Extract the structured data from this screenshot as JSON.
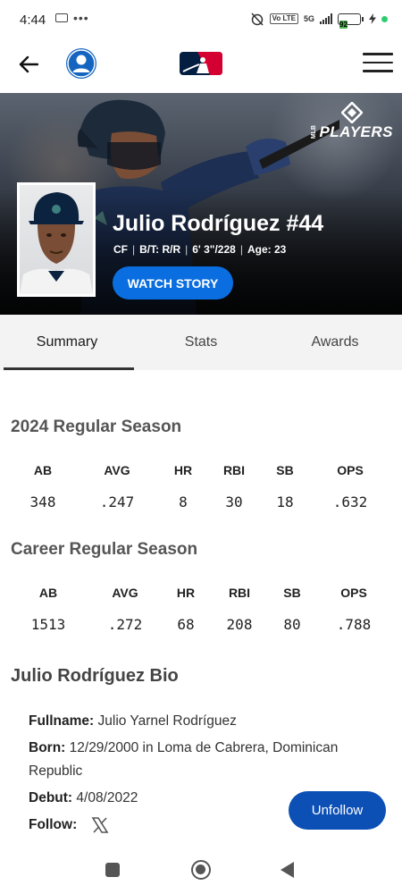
{
  "status_bar": {
    "time": "4:44",
    "dots": "•••",
    "network": "5G",
    "volte": "Vo LTE",
    "battery": "92"
  },
  "header": {
    "back_icon": "arrow-left-icon",
    "profile_icon": "user-circle-icon",
    "logo": "mlb-logo",
    "menu_icon": "hamburger-menu-icon"
  },
  "hero": {
    "players_logo_text": "PLAYERS",
    "players_logo_small": "MLB",
    "player_name": "Julio Rodríguez #44",
    "position": "CF",
    "bats_throws": "B/T: R/R",
    "height_weight": "6' 3\"/228",
    "age": "Age: 23",
    "watch_story_label": "WATCH STORY"
  },
  "tabs": [
    {
      "label": "Summary",
      "active": true
    },
    {
      "label": "Stats",
      "active": false
    },
    {
      "label": "Awards",
      "active": false
    }
  ],
  "season_stats": {
    "title": "2024 Regular Season",
    "headers": [
      "AB",
      "AVG",
      "HR",
      "RBI",
      "SB",
      "OPS"
    ],
    "values": [
      "348",
      ".247",
      "8",
      "30",
      "18",
      ".632"
    ]
  },
  "career_stats": {
    "title": "Career Regular Season",
    "headers": [
      "AB",
      "AVG",
      "HR",
      "RBI",
      "SB",
      "OPS"
    ],
    "values": [
      "1513",
      ".272",
      "68",
      "208",
      "80",
      ".788"
    ]
  },
  "bio": {
    "title": "Julio Rodríguez Bio",
    "fullname_label": "Fullname:",
    "fullname": "Julio Yarnel Rodríguez",
    "born_label": "Born:",
    "born": "12/29/2000 in Loma de Cabrera, Dominican Republic",
    "debut_label": "Debut:",
    "debut": "4/08/2022",
    "follow_label": "Follow:",
    "follow_icon": "x-twitter-icon"
  },
  "unfollow_label": "Unfollow",
  "colors": {
    "accent_blue": "#0a6ee0",
    "unfollow_blue": "#0c4fb5",
    "profile_blue": "#1565c0",
    "mlb_red": "#d50032",
    "mlb_navy": "#041e42"
  }
}
